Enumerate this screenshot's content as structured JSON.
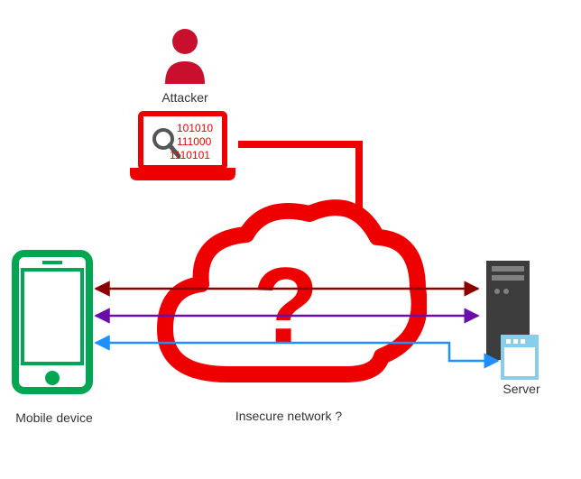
{
  "labels": {
    "attacker": "Attacker",
    "server": "Server",
    "mobile": "Mobile device",
    "network": "Insecure network ?"
  },
  "laptop_screen": {
    "line1": "101010",
    "line2": "111000",
    "line3": "1110101"
  },
  "cloud": {
    "question_mark": "?"
  },
  "colors": {
    "red": "#ee0000",
    "green": "#00a651",
    "darkred": "#8b0000",
    "purple": "#6a0dad",
    "blue": "#1e90ff",
    "darkgray": "#3c3c3c",
    "midgray": "#808080",
    "skyblue": "#87ceeb"
  }
}
